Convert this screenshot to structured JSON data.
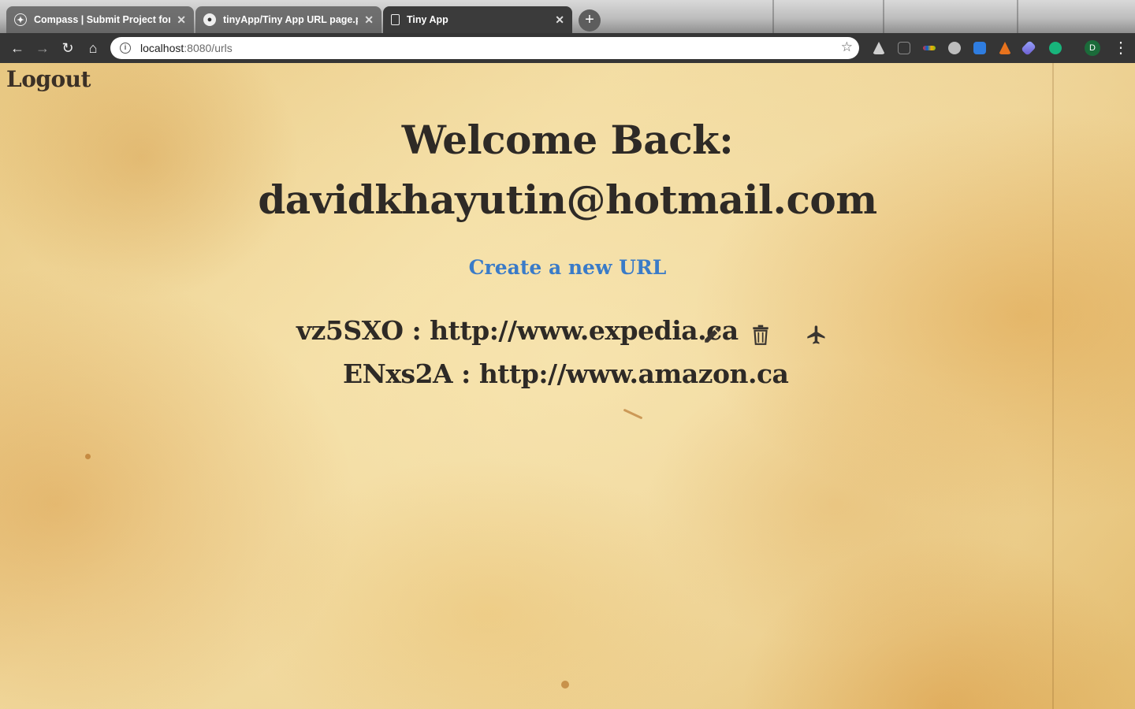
{
  "browser": {
    "tabs": [
      {
        "title": "Compass | Submit Project for E",
        "icon": "compass-icon",
        "active": false
      },
      {
        "title": "tinyApp/Tiny App URL page.png",
        "icon": "github-icon",
        "active": false
      },
      {
        "title": "Tiny App",
        "icon": "page-icon",
        "active": true
      }
    ],
    "address": {
      "host": "localhost",
      "path": ":8080/urls"
    },
    "profile_initial": "D"
  },
  "page": {
    "logout_label": "Logout",
    "welcome_line1": "Welcome Back:",
    "welcome_line2": "davidkhayutin@hotmail.com",
    "create_link_label": "Create a new URL",
    "urls": [
      {
        "short": "vz5SXO",
        "sep": " : ",
        "long": "http://www.expedia.ca",
        "actions": [
          "edit-icon",
          "delete-icon",
          "visit-icon"
        ]
      },
      {
        "short": "ENxs2A",
        "sep": " : ",
        "long": "http://www.amazon.ca",
        "actions": []
      }
    ]
  },
  "colors": {
    "link": "#3a7bc8",
    "text": "#2e2a26",
    "parchment": "#f1d99d"
  }
}
